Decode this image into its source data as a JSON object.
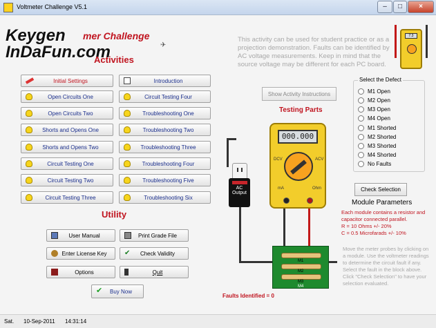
{
  "window": {
    "title": "Voltmeter Challenge V5.1",
    "minimize": "–",
    "maximize": "□",
    "close": "×"
  },
  "header": {
    "watermark_line1": "Keygen",
    "watermark_line2": "InDaFun.com",
    "app_heading": "mer Challenge",
    "activities_title": "Activities",
    "utility_title": "Utility"
  },
  "activities": {
    "initial_settings": "Initial Settings",
    "introduction": "Introduction",
    "left": [
      "Open Circuits One",
      "Open Circuits Two",
      "Shorts and Opens One",
      "Shorts and Opens Two",
      "Circuit Testing One",
      "Circuit Testing Two",
      "Circuit Testing Three"
    ],
    "right": [
      "Circuit Testing Four",
      "Troubleshooting One",
      "Troubleshooting Two",
      "Troubleshooting Three",
      "Troubleshooting Four",
      "Troubleshooting Five",
      "Troubleshooting Six"
    ]
  },
  "utility": {
    "user_manual": "User Manual",
    "print_grade_file": "Print Grade File",
    "enter_license_key": "Enter License Key",
    "check_validity": "Check Validity",
    "options": "Options",
    "quit": "Quit",
    "buy_now": "Buy Now"
  },
  "info": {
    "text": "This activity can be used for student practice or as a projection demonstration. Faults can be identified by AC voltage measurements. Keep in mind that the source voltage may be different for each PC board.",
    "show_instructions": "Show Activity Instructions",
    "testing_parts": "Testing Parts"
  },
  "meter": {
    "reading": "000.000",
    "dcv": "DCV",
    "acv": "ACV",
    "ma": "mA",
    "ohm": "Ohm",
    "corner_reading": "7.3"
  },
  "ac_output": {
    "line1": "AC",
    "line2": "Output"
  },
  "defects": {
    "legend": "Select the Defect",
    "options": [
      "M1 Open",
      "M2 Open",
      "M3 Open",
      "M4 Open",
      "M1 Shorted",
      "M2 Shorted",
      "M3 Shorted",
      "M4 Shorted",
      "No Faults"
    ],
    "check_selection": "Check Selection"
  },
  "module": {
    "title": "Module Parameters",
    "line1": "Each module contains a resistor and capacitor connected parallel.",
    "line2": "R = 10 Ohms +/- 20%",
    "line3": "C = 0.5 Microfarads +/- 10%",
    "help": "Move the meter probes by clicking on a module. Use the voltmeter readings to determine the circuit fault if any. Select the fault in the block above. Click \"Check Selection\" to have your selection evaluated.",
    "labels": [
      "M1",
      "M2",
      "M3",
      "M4"
    ]
  },
  "faults_identified": "Faults Identified = 0",
  "status": {
    "day": "Sat.",
    "date": "10-Sep-2011",
    "time": "14:31:14"
  }
}
